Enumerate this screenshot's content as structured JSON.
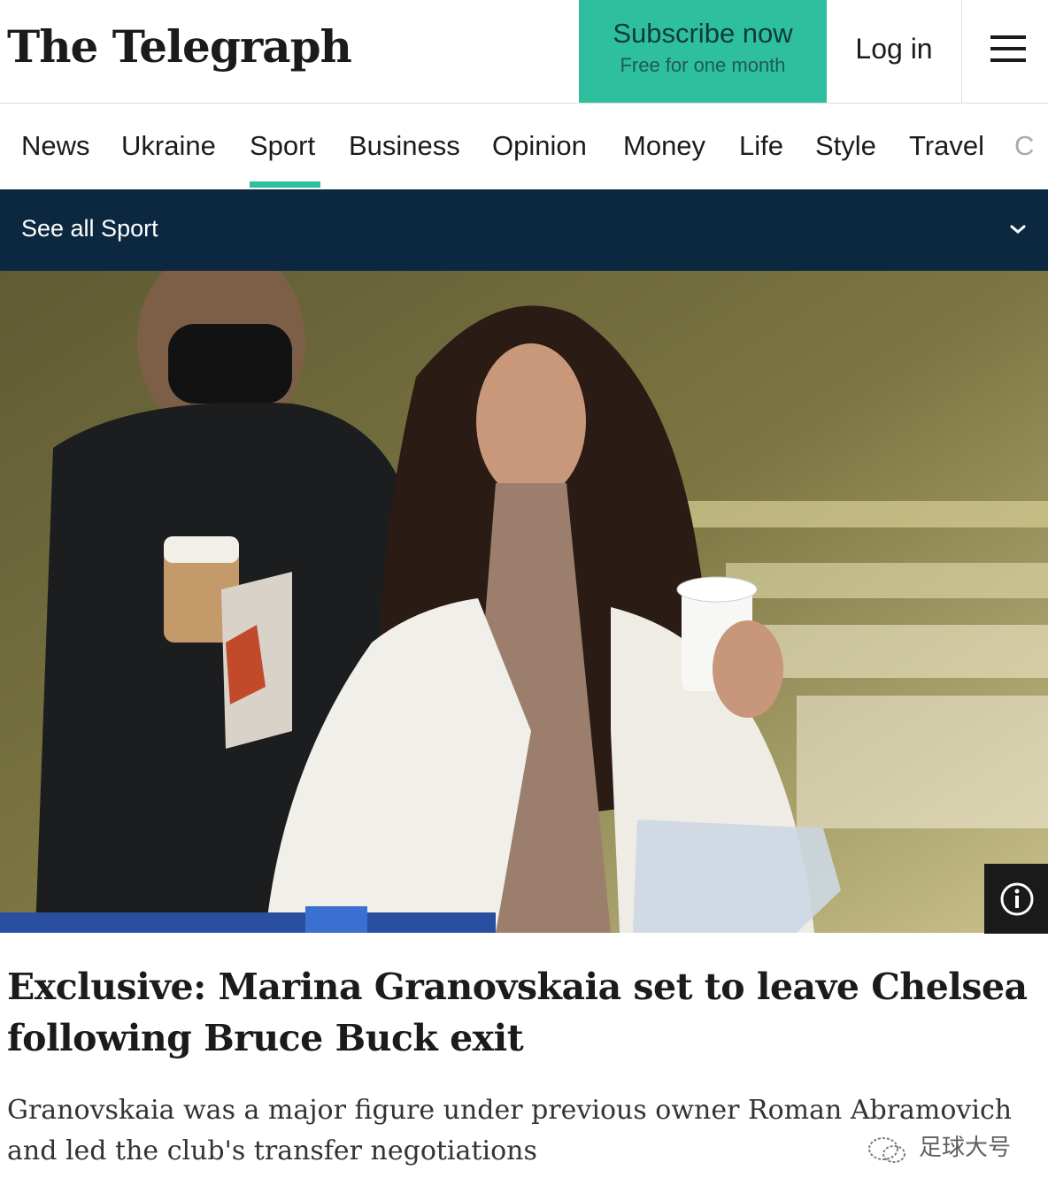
{
  "header": {
    "logo": "The Telegraph",
    "subscribe_title": "Subscribe now",
    "subscribe_sub": "Free for one month",
    "login": "Log in",
    "menu_icon": "hamburger-menu-icon"
  },
  "nav": {
    "items": [
      "News",
      "Ukraine",
      "Sport",
      "Business",
      "Opinion",
      "Money",
      "Life",
      "Style",
      "Travel",
      "C"
    ],
    "active": "Sport"
  },
  "section_bar": {
    "label": "See all Sport",
    "icon": "chevron-down-icon"
  },
  "hero": {
    "info_icon": "info-icon"
  },
  "article": {
    "headline": "Exclusive: Marina Granovskaia set to leave Chelsea following Bruce Buck exit",
    "standfirst": "Granovskaia was a major figure under previous owner Roman Abramovich and led the club's transfer negotiations"
  },
  "watermark": {
    "text": "足球大号"
  },
  "colors": {
    "accent": "#2ebf9e",
    "section_bar": "#0c2840",
    "text": "#1b1b1b"
  }
}
